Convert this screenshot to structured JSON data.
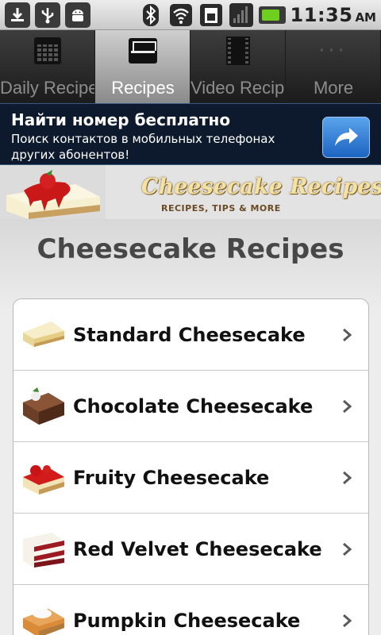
{
  "status_bar": {
    "left_icons": [
      "download-icon",
      "usb-icon",
      "android-icon"
    ],
    "right_icons": [
      "bluetooth-icon",
      "wifi-icon",
      "sim-icon",
      "signal-icon",
      "battery-icon"
    ],
    "time": "11:35",
    "ampm": "AM"
  },
  "tabs": [
    {
      "label": "Daily Recipes",
      "icon": "calendar-icon",
      "active": false
    },
    {
      "label": "Recipes",
      "icon": "inbox-tray-icon",
      "active": true
    },
    {
      "label": "Video Recipe",
      "icon": "film-icon",
      "active": false
    },
    {
      "label": "More",
      "icon": "more-dots-icon",
      "active": false
    }
  ],
  "ad": {
    "title": "Найти номер бесплатно",
    "text": "Поиск контактов в мобильных телефонах других абонентов!",
    "button_icon": "share-arrow-icon",
    "colors": {
      "background": "#0d1a2d",
      "button": "#2f7fd9"
    }
  },
  "banner": {
    "logo_text": "Cheesecake Recipes!",
    "tagline": "RECIPES, TIPS & MORE"
  },
  "page": {
    "title": "Cheesecake Recipes"
  },
  "recipes": [
    {
      "label": "Standard Cheesecake",
      "icon": "plain-cheesecake-icon"
    },
    {
      "label": "Chocolate Cheesecake",
      "icon": "chocolate-cheesecake-icon"
    },
    {
      "label": "Fruity Cheesecake",
      "icon": "strawberry-cheesecake-icon"
    },
    {
      "label": "Red Velvet Cheesecake",
      "icon": "red-velvet-cheesecake-icon"
    },
    {
      "label": "Pumpkin Cheesecake",
      "icon": "pumpkin-cheesecake-icon"
    }
  ]
}
